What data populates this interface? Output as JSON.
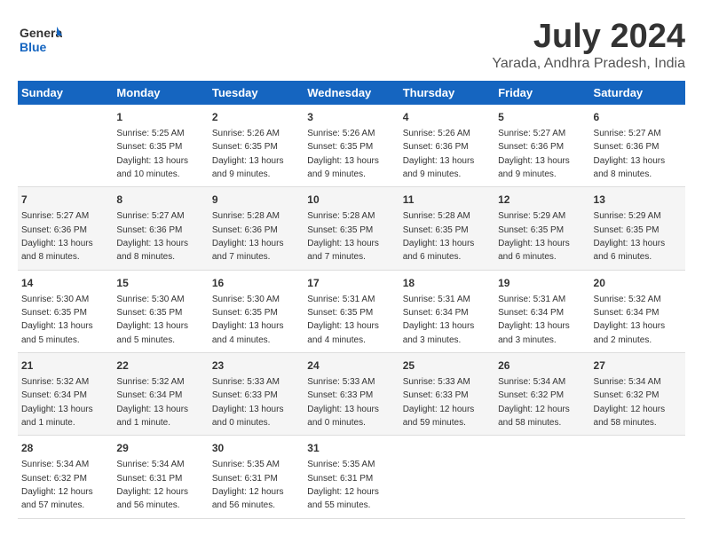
{
  "logo": {
    "line1": "General",
    "line2": "Blue"
  },
  "title": "July 2024",
  "subtitle": "Yarada, Andhra Pradesh, India",
  "weekdays": [
    "Sunday",
    "Monday",
    "Tuesday",
    "Wednesday",
    "Thursday",
    "Friday",
    "Saturday"
  ],
  "weeks": [
    [
      null,
      {
        "day": "1",
        "sunrise": "5:25 AM",
        "sunset": "6:35 PM",
        "daylight": "13 hours and 10 minutes."
      },
      {
        "day": "2",
        "sunrise": "5:26 AM",
        "sunset": "6:35 PM",
        "daylight": "13 hours and 9 minutes."
      },
      {
        "day": "3",
        "sunrise": "5:26 AM",
        "sunset": "6:35 PM",
        "daylight": "13 hours and 9 minutes."
      },
      {
        "day": "4",
        "sunrise": "5:26 AM",
        "sunset": "6:36 PM",
        "daylight": "13 hours and 9 minutes."
      },
      {
        "day": "5",
        "sunrise": "5:27 AM",
        "sunset": "6:36 PM",
        "daylight": "13 hours and 9 minutes."
      },
      {
        "day": "6",
        "sunrise": "5:27 AM",
        "sunset": "6:36 PM",
        "daylight": "13 hours and 8 minutes."
      }
    ],
    [
      {
        "day": "7",
        "sunrise": "5:27 AM",
        "sunset": "6:36 PM",
        "daylight": "13 hours and 8 minutes."
      },
      {
        "day": "8",
        "sunrise": "5:27 AM",
        "sunset": "6:36 PM",
        "daylight": "13 hours and 8 minutes."
      },
      {
        "day": "9",
        "sunrise": "5:28 AM",
        "sunset": "6:36 PM",
        "daylight": "13 hours and 7 minutes."
      },
      {
        "day": "10",
        "sunrise": "5:28 AM",
        "sunset": "6:35 PM",
        "daylight": "13 hours and 7 minutes."
      },
      {
        "day": "11",
        "sunrise": "5:28 AM",
        "sunset": "6:35 PM",
        "daylight": "13 hours and 6 minutes."
      },
      {
        "day": "12",
        "sunrise": "5:29 AM",
        "sunset": "6:35 PM",
        "daylight": "13 hours and 6 minutes."
      },
      {
        "day": "13",
        "sunrise": "5:29 AM",
        "sunset": "6:35 PM",
        "daylight": "13 hours and 6 minutes."
      }
    ],
    [
      {
        "day": "14",
        "sunrise": "5:30 AM",
        "sunset": "6:35 PM",
        "daylight": "13 hours and 5 minutes."
      },
      {
        "day": "15",
        "sunrise": "5:30 AM",
        "sunset": "6:35 PM",
        "daylight": "13 hours and 5 minutes."
      },
      {
        "day": "16",
        "sunrise": "5:30 AM",
        "sunset": "6:35 PM",
        "daylight": "13 hours and 4 minutes."
      },
      {
        "day": "17",
        "sunrise": "5:31 AM",
        "sunset": "6:35 PM",
        "daylight": "13 hours and 4 minutes."
      },
      {
        "day": "18",
        "sunrise": "5:31 AM",
        "sunset": "6:34 PM",
        "daylight": "13 hours and 3 minutes."
      },
      {
        "day": "19",
        "sunrise": "5:31 AM",
        "sunset": "6:34 PM",
        "daylight": "13 hours and 3 minutes."
      },
      {
        "day": "20",
        "sunrise": "5:32 AM",
        "sunset": "6:34 PM",
        "daylight": "13 hours and 2 minutes."
      }
    ],
    [
      {
        "day": "21",
        "sunrise": "5:32 AM",
        "sunset": "6:34 PM",
        "daylight": "13 hours and 1 minute."
      },
      {
        "day": "22",
        "sunrise": "5:32 AM",
        "sunset": "6:34 PM",
        "daylight": "13 hours and 1 minute."
      },
      {
        "day": "23",
        "sunrise": "5:33 AM",
        "sunset": "6:33 PM",
        "daylight": "13 hours and 0 minutes."
      },
      {
        "day": "24",
        "sunrise": "5:33 AM",
        "sunset": "6:33 PM",
        "daylight": "13 hours and 0 minutes."
      },
      {
        "day": "25",
        "sunrise": "5:33 AM",
        "sunset": "6:33 PM",
        "daylight": "12 hours and 59 minutes."
      },
      {
        "day": "26",
        "sunrise": "5:34 AM",
        "sunset": "6:32 PM",
        "daylight": "12 hours and 58 minutes."
      },
      {
        "day": "27",
        "sunrise": "5:34 AM",
        "sunset": "6:32 PM",
        "daylight": "12 hours and 58 minutes."
      }
    ],
    [
      {
        "day": "28",
        "sunrise": "5:34 AM",
        "sunset": "6:32 PM",
        "daylight": "12 hours and 57 minutes."
      },
      {
        "day": "29",
        "sunrise": "5:34 AM",
        "sunset": "6:31 PM",
        "daylight": "12 hours and 56 minutes."
      },
      {
        "day": "30",
        "sunrise": "5:35 AM",
        "sunset": "6:31 PM",
        "daylight": "12 hours and 56 minutes."
      },
      {
        "day": "31",
        "sunrise": "5:35 AM",
        "sunset": "6:31 PM",
        "daylight": "12 hours and 55 minutes."
      },
      null,
      null,
      null
    ]
  ]
}
